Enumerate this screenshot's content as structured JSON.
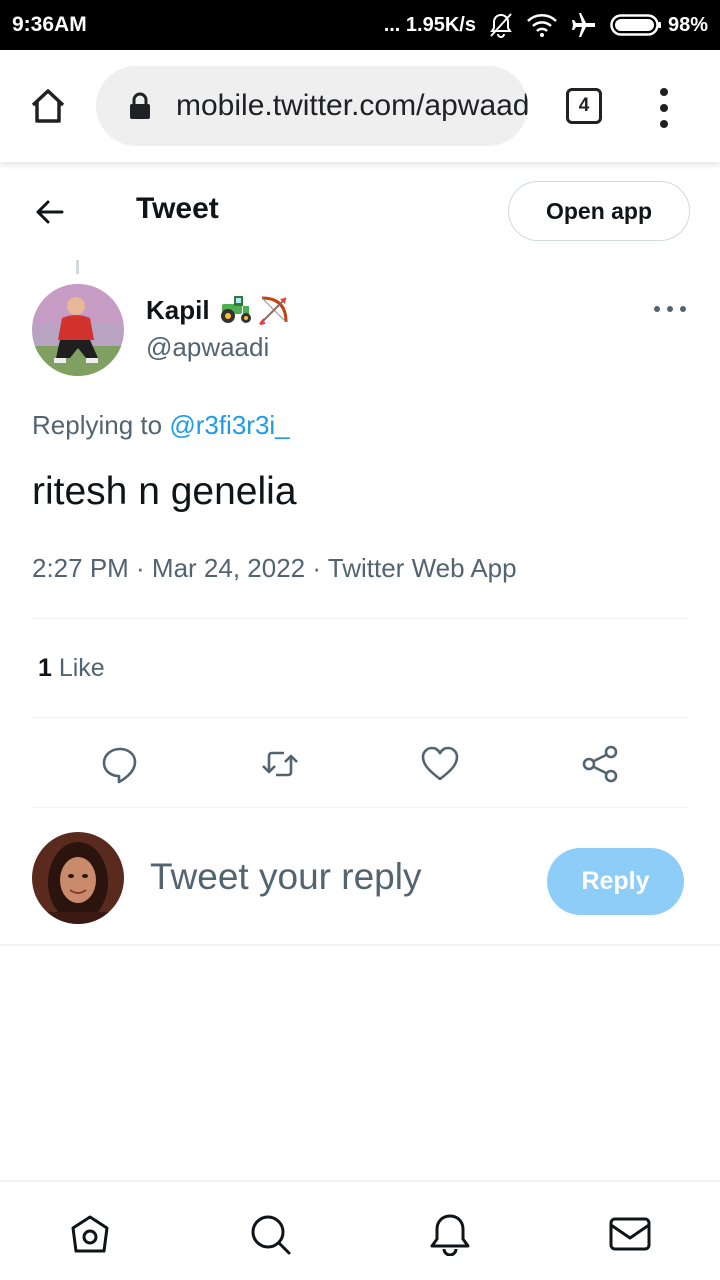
{
  "status_bar": {
    "time": "9:36AM",
    "network_speed": "... 1.95K/s",
    "battery": "98%",
    "icons": [
      "bell-off-icon",
      "wifi-icon",
      "airplane-mode-icon",
      "battery-icon"
    ]
  },
  "browser": {
    "url": "mobile.twitter.com/apwaadi/status",
    "tab_count": "4",
    "icons": [
      "home-icon",
      "lock-icon",
      "tab-switcher-icon",
      "overflow-menu-icon"
    ]
  },
  "header": {
    "title": "Tweet",
    "open_app_label": "Open app",
    "icons": [
      "back-arrow-icon"
    ]
  },
  "tweet": {
    "author_name": "Kapil",
    "author_emojis": [
      "tractor-emoji",
      "bow-and-arrow-emoji"
    ],
    "author_handle": "@apwaadi",
    "replying_prefix": "Replying to ",
    "replying_to": "@r3fi3r3i_",
    "text": "ritesh n genelia",
    "meta": "2:27 PM · Mar 24, 2022 · Twitter Web App",
    "like_count": "1",
    "like_label": " Like",
    "actions": [
      "reply-icon",
      "retweet-icon",
      "like-heart-icon",
      "share-icon"
    ]
  },
  "composer": {
    "placeholder": "Tweet your reply",
    "reply_label": "Reply"
  },
  "bottom_nav": {
    "items": [
      "home-icon",
      "search-icon",
      "notifications-bell-icon",
      "messages-mail-icon"
    ]
  },
  "colors": {
    "accent": "#1d9bf0",
    "reply_button_disabled": "#8ecdf8",
    "secondary_text": "#536471",
    "primary_text": "#0f1419"
  }
}
